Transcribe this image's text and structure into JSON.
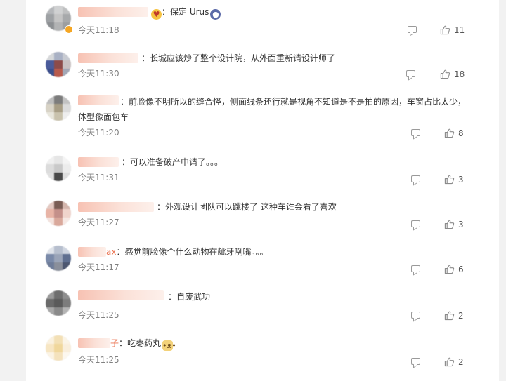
{
  "comments": [
    {
      "text": "：保定 Urus",
      "time": "今天11:18",
      "likes": "11"
    },
    {
      "text": "：长城应该炒了整个设计院，从外面重新请设计师了",
      "time": "今天11:30",
      "likes": "18"
    },
    {
      "text": "：前脸像不明所以的缝合怪，侧面线条还行就是视角不知道是不是拍的原因，车窗占比太少，体型像面包车",
      "time": "今天11:20",
      "likes": "8"
    },
    {
      "text": "：可以准备破产申请了。。。",
      "time": "今天11:31",
      "likes": "3"
    },
    {
      "text": "：外观设计团队可以跳楼了 这种车谁会看了喜欢",
      "time": "今天11:27",
      "likes": "3"
    },
    {
      "name_suffix": "ax",
      "text": "：感觉前脸像个什么动物在龇牙咧嘴。。。",
      "time": "今天11:17",
      "likes": "6"
    },
    {
      "text": "：自废武功",
      "time": "今天11:25",
      "likes": "2"
    },
    {
      "name_suffix": "子",
      "text": "：吃枣药丸",
      "time": "今天11:25",
      "likes": "2"
    }
  ],
  "colors": {
    "accent": "#333333",
    "muted": "#808080",
    "name_blur": "#f7c2b3",
    "verified": "#f5a623"
  },
  "icons": [
    "reply-icon",
    "like-icon",
    "emoji-icon",
    "verified-icon"
  ]
}
